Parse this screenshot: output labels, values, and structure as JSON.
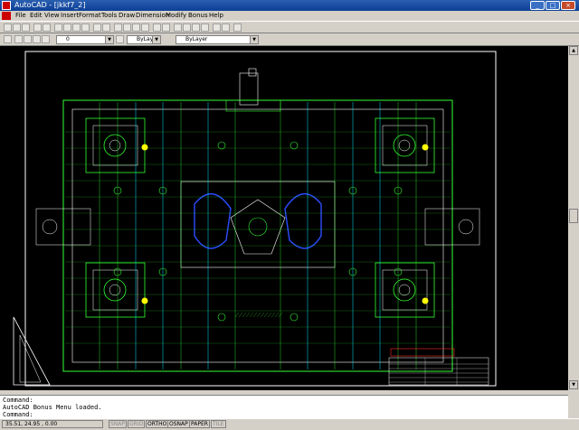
{
  "window": {
    "title": "AutoCAD - [jkkf7_2]"
  },
  "menu": {
    "items": [
      "File",
      "Edit",
      "View",
      "Insert",
      "Format",
      "Tools",
      "Draw",
      "Dimension",
      "Modify",
      "Bonus",
      "Help"
    ]
  },
  "layers": {
    "layer_name": "0",
    "color": "ByLayer",
    "linetype": "ByLayer"
  },
  "command_area": {
    "lines": [
      "Command:",
      "AutoCAD Bonus Menu loaded.",
      "Command:"
    ]
  },
  "status": {
    "coordinates": "35.51, 24.95 , 0.00",
    "modes": [
      {
        "label": "SNAP",
        "on": false
      },
      {
        "label": "GRID",
        "on": false
      },
      {
        "label": "ORTHO",
        "on": true
      },
      {
        "label": "OSNAP",
        "on": true
      },
      {
        "label": "PAPER",
        "on": true
      },
      {
        "label": "TILE",
        "on": false
      }
    ]
  },
  "colors": {
    "canvas": "#000000",
    "primary_lines": "#33ff33",
    "secondary_lines": "#ffffff",
    "accent_cyan": "#00e5ff",
    "accent_blue": "#2a4dff",
    "accent_yellow": "#ffff00",
    "accent_red": "#ff2a2a"
  }
}
